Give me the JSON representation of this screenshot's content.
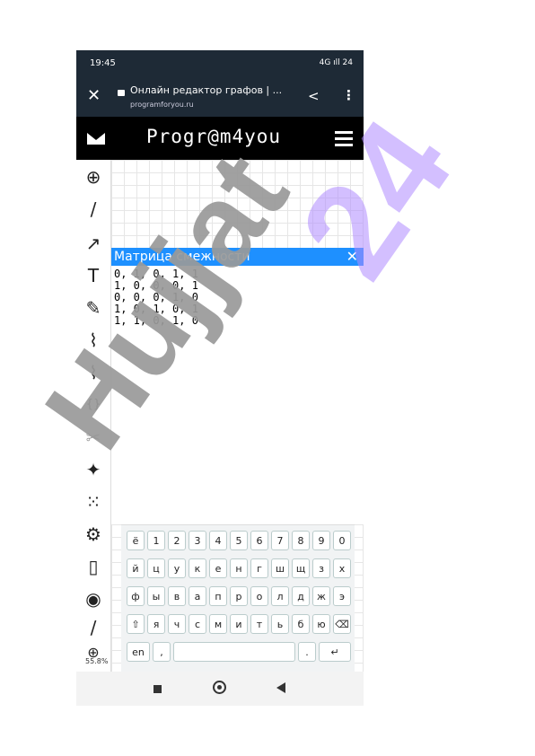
{
  "status": {
    "time": "19:45",
    "right": "4G ıll 24"
  },
  "browser": {
    "close": "✕",
    "title": "Онлайн редактор графов | ...",
    "url": "programforyou.ru",
    "share": "<",
    "menu": "⋮"
  },
  "site": {
    "logo": "Progr@m4you"
  },
  "tools": [
    {
      "icon": "⊕",
      "name": "add-vertex-icon"
    },
    {
      "icon": "/",
      "name": "edge-icon"
    },
    {
      "icon": "↗",
      "name": "arc-icon"
    },
    {
      "icon": "T",
      "name": "text-icon"
    },
    {
      "icon": "✎",
      "name": "brush-icon"
    },
    {
      "icon": "⌇",
      "name": "image-icon"
    },
    {
      "icon": "⌇",
      "name": "export-icon"
    },
    {
      "icon": "{}",
      "name": "matrix-icon"
    },
    {
      "icon": "✂",
      "name": "disconnect-icon"
    },
    {
      "icon": "✦",
      "name": "magic-wand-icon"
    },
    {
      "icon": "⁙",
      "name": "grid-icon"
    },
    {
      "icon": "⚙",
      "name": "gear-icon"
    },
    {
      "icon": "▯",
      "name": "book-icon"
    },
    {
      "icon": "◉",
      "name": "vertex-target-icon"
    },
    {
      "icon": "/",
      "name": "edge-target-icon"
    },
    {
      "icon": "⊕",
      "name": "zoom-icon"
    }
  ],
  "zoom": "55.8%",
  "matrix": {
    "title": "Матрица смежности",
    "close": "✕",
    "rows": [
      "0, 1, 0, 1, 1",
      "1, 0, 0, 0, 1",
      "0, 0, 0, 1, 0",
      "1, 0, 1, 0, 1",
      "1, 1, 0, 1, 0"
    ]
  },
  "keyboard": {
    "rows": [
      [
        "ё",
        "1",
        "2",
        "3",
        "4",
        "5",
        "6",
        "7",
        "8",
        "9",
        "0"
      ],
      [
        "й",
        "ц",
        "у",
        "к",
        "е",
        "н",
        "г",
        "ш",
        "щ",
        "з",
        "х"
      ],
      [
        "ф",
        "ы",
        "в",
        "а",
        "п",
        "р",
        "о",
        "л",
        "д",
        "ж",
        "э"
      ],
      [
        "⇧",
        "я",
        "ч",
        "с",
        "м",
        "и",
        "т",
        "ь",
        "б",
        "ю",
        "⌫"
      ],
      [
        "en",
        ",",
        "",
        ".",
        "↵"
      ]
    ]
  },
  "watermarks": {
    "a": "Hujjat",
    "b": "24"
  }
}
